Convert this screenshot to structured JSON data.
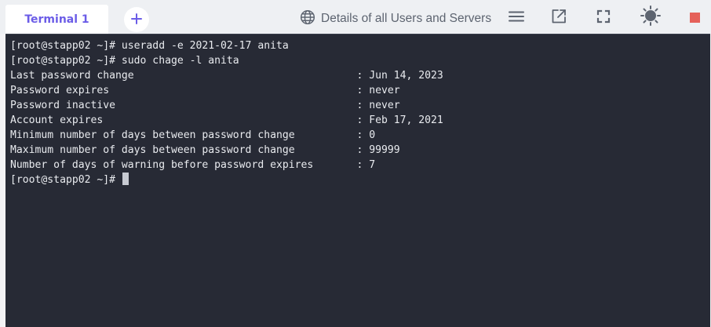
{
  "tabs": [
    {
      "label": "Terminal 1"
    }
  ],
  "header": {
    "details_label": "Details of all Users and Servers"
  },
  "icons": {
    "add_tab": "plus-icon",
    "globe": "globe-icon",
    "menu": "hamburger-menu-icon",
    "open_external": "external-link-icon",
    "fullscreen": "fullscreen-icon",
    "theme": "sun-icon",
    "stop": "stop-icon"
  },
  "colors": {
    "tab_accent": "#6b5ce7",
    "terminal_bg": "#272a35",
    "terminal_fg": "#e9ebef",
    "stop": "#e5615a"
  },
  "terminal": {
    "lines": [
      "[root@stapp02 ~]# useradd -e 2021-02-17 anita",
      "[root@stapp02 ~]# sudo chage -l anita",
      "Last password change                                    : Jun 14, 2023",
      "Password expires                                        : never",
      "Password inactive                                       : never",
      "Account expires                                         : Feb 17, 2021",
      "Minimum number of days between password change          : 0",
      "Maximum number of days between password change          : 99999",
      "Number of days of warning before password expires       : 7"
    ],
    "prompt": "[root@stapp02 ~]# "
  }
}
